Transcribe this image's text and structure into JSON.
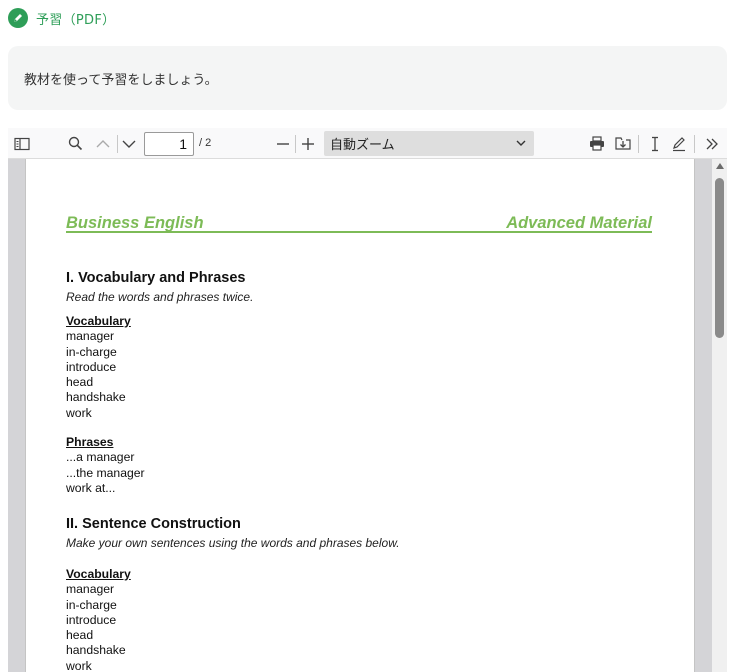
{
  "header": {
    "title": "予習（PDF）",
    "icon": "pencil-icon",
    "color": "#2e9e58"
  },
  "notice": {
    "text": "教材を使って予習をしましょう。"
  },
  "toolbar": {
    "page_current": "1",
    "page_total": "/ 2",
    "zoom": "自動ズーム"
  },
  "document": {
    "header_left": "Business English",
    "header_right": "Advanced Material",
    "accent_color": "#7dbb57",
    "section1": {
      "title": "I. Vocabulary and Phrases",
      "subtitle": "Read the words and phrases twice.",
      "vocab_heading": "Vocabulary",
      "vocab": [
        "manager",
        "in-charge",
        "introduce",
        "head",
        "handshake",
        "work"
      ],
      "phrases_heading": "Phrases",
      "phrases": [
        "...a manager",
        "...the manager",
        "work at..."
      ]
    },
    "section2": {
      "title": "II. Sentence Construction",
      "subtitle": "Make your own sentences using the words and phrases below.",
      "vocab_heading": "Vocabulary",
      "vocab": [
        "manager",
        "in-charge",
        "introduce",
        "head",
        "handshake",
        "work"
      ]
    }
  }
}
